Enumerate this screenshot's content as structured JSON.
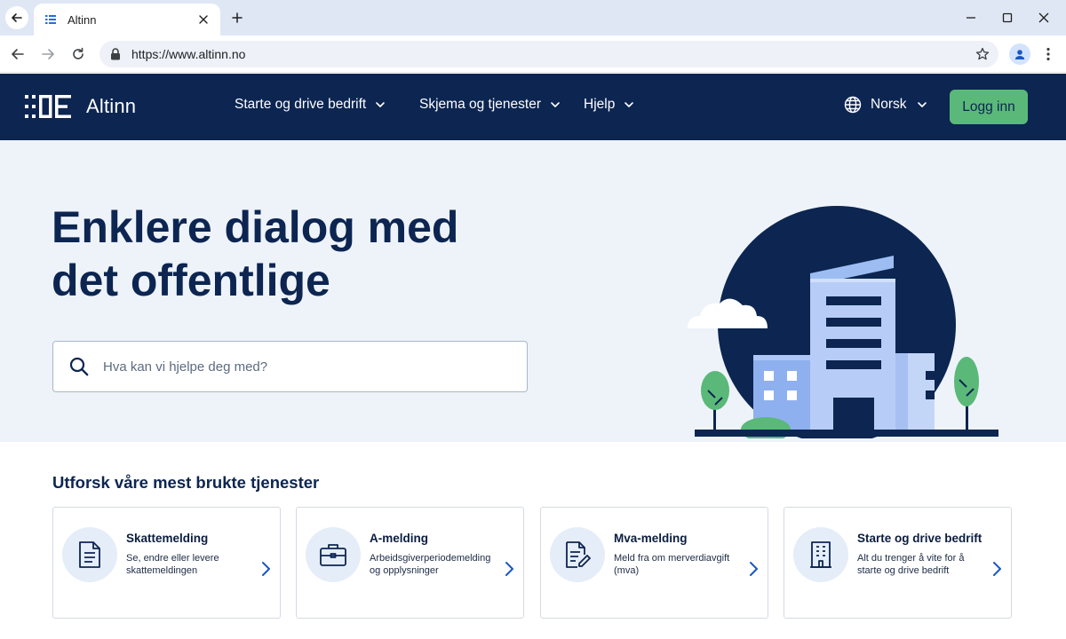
{
  "browser": {
    "tab_title": "Altinn",
    "url": "https://www.altinn.no",
    "icons": [
      "back-icon",
      "close-icon",
      "plus-icon",
      "minimize-icon",
      "maximize-icon",
      "window-close-icon",
      "forward-icon",
      "reload-icon",
      "lock-icon",
      "star-icon",
      "profile-icon",
      "more-icon"
    ]
  },
  "header": {
    "brand": "Altinn",
    "nav": [
      {
        "label": "Starte og drive bedrift"
      },
      {
        "label": "Skjema og tjenester"
      },
      {
        "label": "Hjelp"
      }
    ],
    "language": "Norsk",
    "login_label": "Logg inn",
    "colors": {
      "background": "#0c2551",
      "login": "#5ab978"
    }
  },
  "hero": {
    "title_line1": "Enklere dialog med",
    "title_line2": "det offentlige",
    "search_placeholder": "Hva kan vi hjelpe deg med?",
    "background": "#eef3fa"
  },
  "services": {
    "title": "Utforsk våre mest brukte tjenester",
    "cards": [
      {
        "title": "Skattemelding",
        "desc": "Se, endre eller levere skattemeldingen",
        "icon": "document-icon"
      },
      {
        "title": "A-melding",
        "desc": "Arbeidsgiverperiodemelding og opplysninger",
        "icon": "briefcase-icon"
      },
      {
        "title": "Mva-melding",
        "desc": "Meld fra om merverdiavgift (mva)",
        "icon": "document-pen-icon"
      },
      {
        "title": "Starte og drive bedrift",
        "desc": "Alt du trenger å vite for å starte og drive bedrift",
        "icon": "building-icon"
      }
    ]
  }
}
